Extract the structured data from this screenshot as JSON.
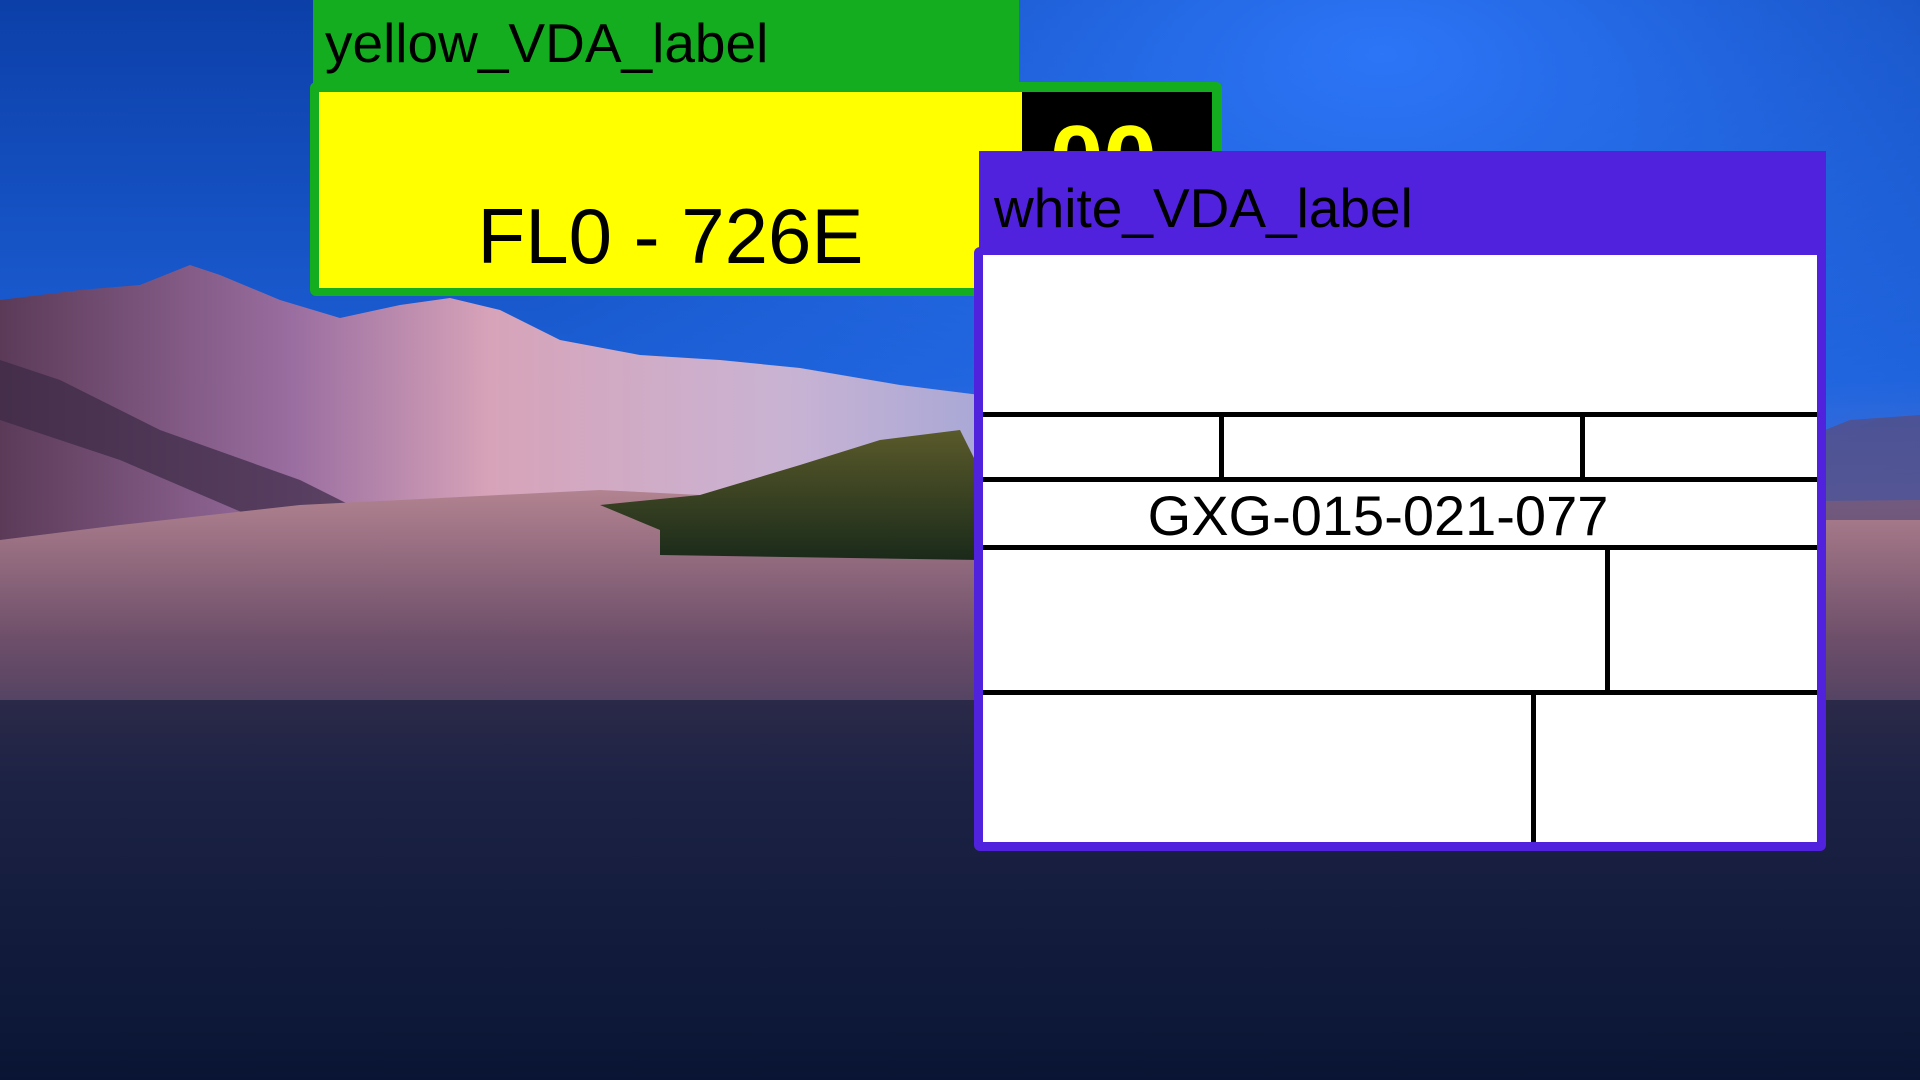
{
  "yellow_window": {
    "title": "yellow_VDA_label",
    "plate_number": "FL0 - 726E",
    "badge_text": "00",
    "title_bar_color": "#13ad1f",
    "label_color": "#ffff00"
  },
  "white_window": {
    "title": "white_VDA_label",
    "label_code": "GXG-015-021-077",
    "title_bar_color": "#5022dd",
    "label_color": "#ffffff"
  },
  "wallpaper": {
    "scene": "mountain-lake-icon"
  }
}
